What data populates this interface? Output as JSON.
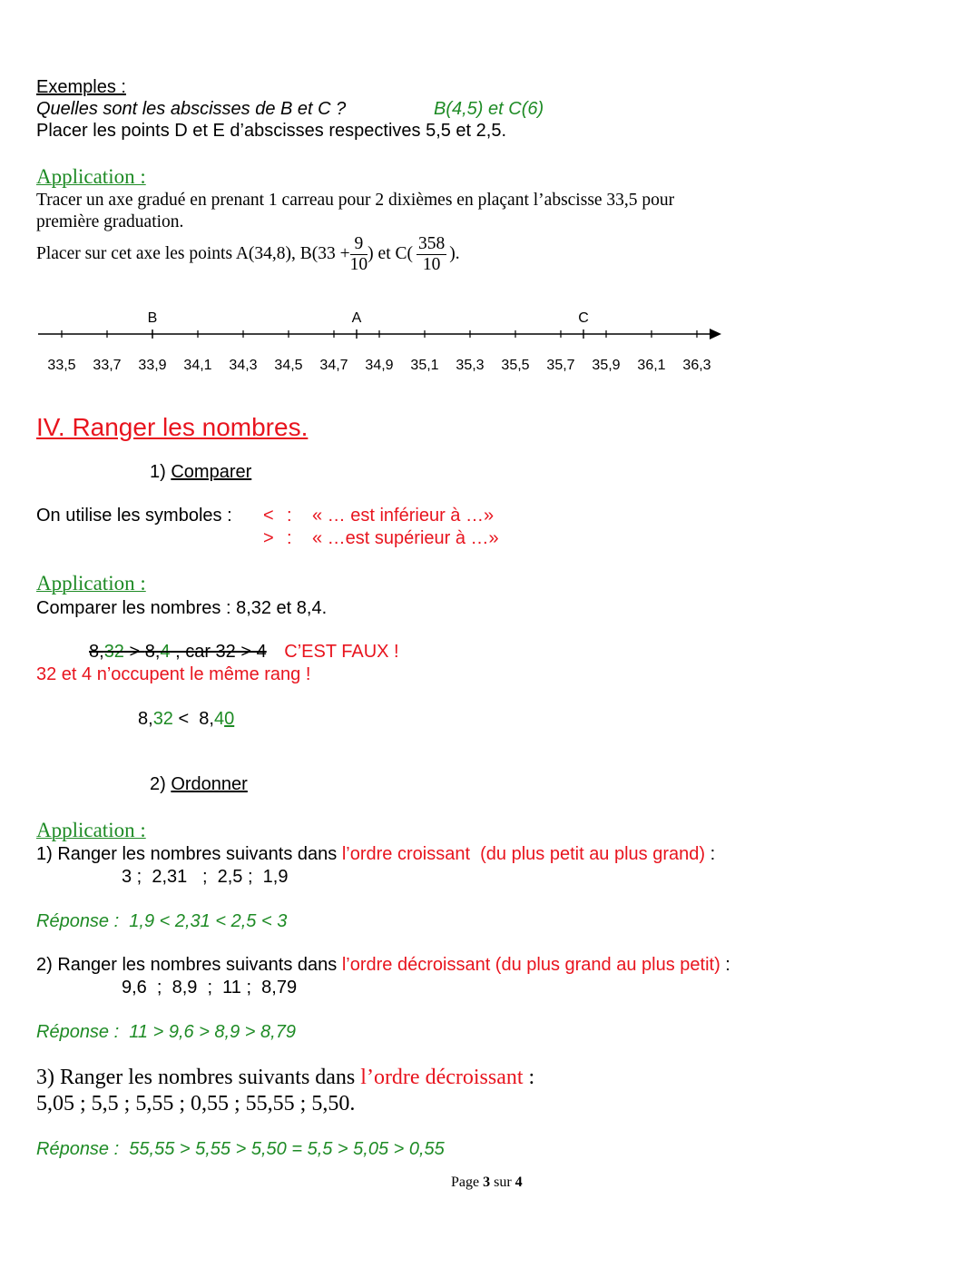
{
  "examples": {
    "heading": "Exemples :",
    "question": "Quelles sont les abscisses de B et C ?",
    "answer": "B(4,5) et C(6)",
    "instruction": "Placer les points D et E d’abscisses respectives 5,5 et 2,5."
  },
  "application1": {
    "heading": "Application :",
    "line1": "Tracer un axe gradué en prenant 1 carreau pour 2 dixièmes en plaçant l’abscisse 33,5 pour",
    "line2": "première graduation.",
    "line3_prefix": "Placer sur cet axe les points A(34,8), B(33 + ",
    "frac1_num": "9",
    "frac1_den": "10",
    "line3_mid": ") et C(",
    "frac2_num": "358",
    "frac2_den": "10",
    "line3_suffix": ")."
  },
  "number_line": {
    "ticks": [
      "33,5",
      "33,7",
      "33,9",
      "34,1",
      "34,3",
      "34,5",
      "34,7",
      "34,9",
      "35,1",
      "35,3",
      "35,5",
      "35,7",
      "35,9",
      "36,1",
      "36,3"
    ],
    "start": 33.5,
    "step": 0.2,
    "points": [
      {
        "label": "B",
        "value": 33.9
      },
      {
        "label": "A",
        "value": 34.8
      },
      {
        "label": "C",
        "value": 35.8
      }
    ]
  },
  "section4": {
    "title": "IV.  Ranger les nombres.",
    "sub1_number": "1) ",
    "sub1_title": "Comparer",
    "symbols_intro": "On utilise les symboles :",
    "symbols": [
      {
        "sym": "<",
        "sep": ":",
        "desc": "« … est inférieur à …»"
      },
      {
        "sym": ">",
        "sep": ":",
        "desc": "« …est supérieur à …»"
      }
    ]
  },
  "application2": {
    "heading": "Application :",
    "prompt": "Comparer les nombres : 8,32 et 8,4.",
    "wrong": {
      "a_int": "8,",
      "a_dec": "32",
      "op": " > ",
      "b_int": "8,",
      "b_dec": "4",
      "reason": " , car 32 > 4"
    },
    "wrong_label": "C’EST FAUX !",
    "explanation": "32 et 4 n’occupent le même rang !",
    "correct": {
      "a_int": "8,",
      "a_dec": "32",
      "op": " <  ",
      "b_int": "8,",
      "b_dec": "4",
      "b_zero": "0"
    }
  },
  "ordonner": {
    "sub2_number": "2) ",
    "sub2_title": "Ordonner"
  },
  "application3": {
    "heading": "Application :",
    "q1_prefix": "1) Ranger les nombres suivants dans ",
    "q1_red": "l’ordre croissant  (du plus petit au plus grand)",
    "q1_suffix": " :",
    "q1_numbers": "3 ;  2,31   ;  2,5 ;  1,9",
    "q1_answer": "Réponse :  1,9 < 2,31 < 2,5 < 3",
    "q2_prefix": "2) Ranger les nombres suivants dans ",
    "q2_red": "l’ordre décroissant (du plus grand au plus petit)",
    "q2_suffix": " :",
    "q2_numbers": "9,6  ;  8,9  ;  11 ;  8,79",
    "q2_answer": "Réponse :  11 > 9,6 > 8,9 > 8,79",
    "q3_prefix": "3) Ranger les nombres suivants dans ",
    "q3_red": "l’ordre décroissant",
    "q3_suffix": " :",
    "q3_numbers": "5,05 ; 5,5 ; 5,55 ; 0,55 ; 55,55 ; 5,50.",
    "q3_answer": "Réponse :  55,55 > 5,55 > 5,50 = 5,5 > 5,05 > 0,55"
  },
  "footer": {
    "page_word": "Page ",
    "page_num": "3",
    "sur": " sur ",
    "total": "4"
  }
}
